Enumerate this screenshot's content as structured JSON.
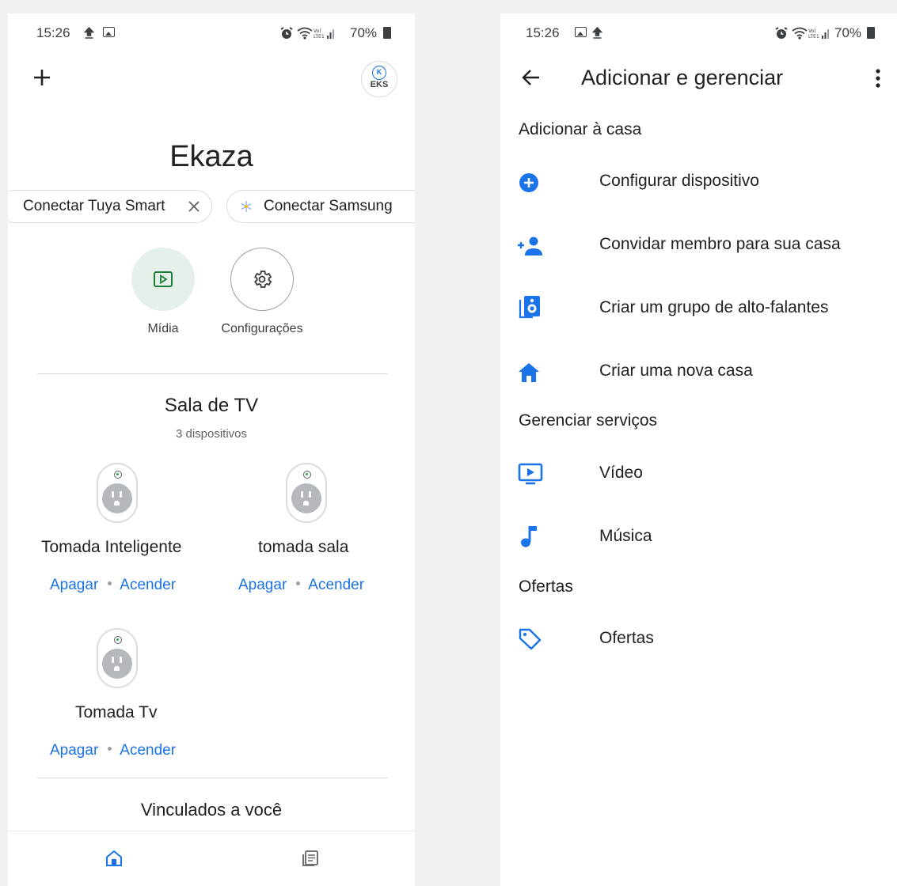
{
  "status_left": {
    "time": "15:26",
    "battery": "70%"
  },
  "status_right": {
    "time": "15:26",
    "battery": "70%"
  },
  "home": {
    "add_icon": "plus-icon",
    "avatar_text": "EKS",
    "avatar_logo": "K",
    "title": "Ekaza",
    "chips": [
      {
        "label": "Conectar Tuya Smart",
        "icon": "close-icon"
      },
      {
        "label": "Conectar Samsung",
        "icon": "snowflake-icon"
      }
    ],
    "actions": [
      {
        "label": "Mídia",
        "icon": "media-play-icon"
      },
      {
        "label": "Configurações",
        "icon": "gear-icon"
      }
    ],
    "room": {
      "title": "Sala de TV",
      "subtitle": "3 dispositivos",
      "devices": [
        {
          "name": "Tomada Inteligente",
          "off_label": "Apagar",
          "on_label": "Acender"
        },
        {
          "name": "tomada sala",
          "off_label": "Apagar",
          "on_label": "Acender"
        },
        {
          "name": "Tomada Tv",
          "off_label": "Apagar",
          "on_label": "Acender"
        }
      ]
    },
    "linked_title": "Vinculados a você",
    "bottom_nav": [
      {
        "icon": "home-icon",
        "active": true
      },
      {
        "icon": "feed-icon",
        "active": false
      }
    ]
  },
  "manage": {
    "title": "Adicionar e gerenciar",
    "sections": [
      {
        "title": "Adicionar à casa",
        "items": [
          {
            "label": "Configurar dispositivo",
            "icon": "add-circle-icon"
          },
          {
            "label": "Convidar membro para sua casa",
            "icon": "person-add-icon"
          },
          {
            "label": "Criar um grupo de alto-falantes",
            "icon": "speaker-group-icon"
          },
          {
            "label": "Criar uma nova casa",
            "icon": "home-icon"
          }
        ]
      },
      {
        "title": "Gerenciar serviços",
        "items": [
          {
            "label": "Vídeo",
            "icon": "video-icon"
          },
          {
            "label": "Música",
            "icon": "music-note-icon"
          }
        ]
      },
      {
        "title": "Ofertas",
        "items": [
          {
            "label": "Ofertas",
            "icon": "tag-icon"
          }
        ]
      }
    ]
  },
  "colors": {
    "accent": "#1a73e8",
    "media_bg": "#e6f0ea",
    "text": "#202124",
    "secondary": "#5f6368"
  }
}
